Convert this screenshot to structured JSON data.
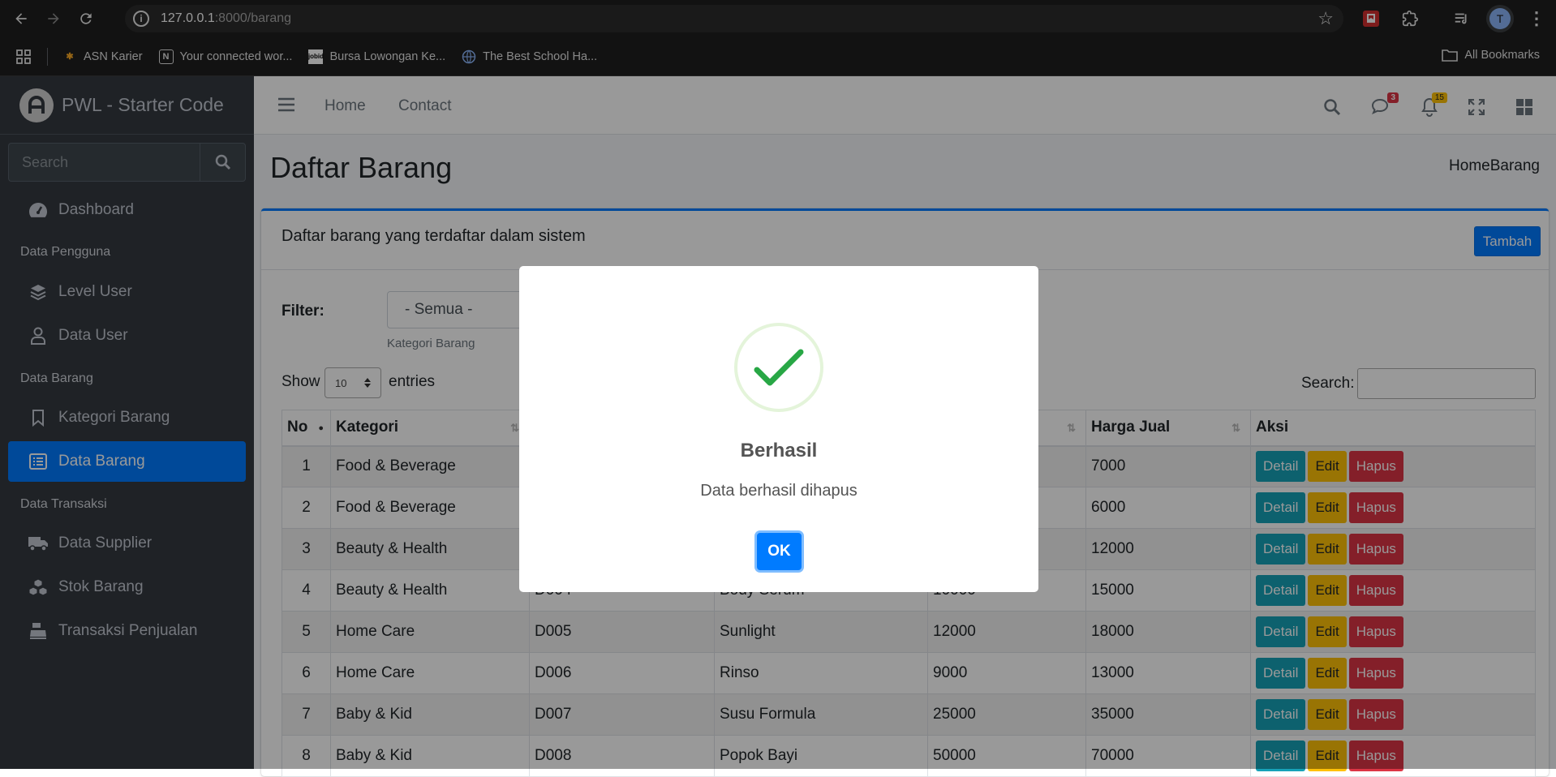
{
  "browser": {
    "url_host": "127.0.0.1",
    "url_rest": ":8000/barang",
    "profile_initial": "T",
    "bookmarks": [
      {
        "label": "ASN Karier"
      },
      {
        "label": "Your connected wor..."
      },
      {
        "label": "Bursa Lowongan Ke..."
      },
      {
        "label": "The Best School Ha..."
      }
    ],
    "all_bookmarks": "All Bookmarks"
  },
  "sidebar": {
    "brand": "PWL - Starter Code",
    "search_placeholder": "Search",
    "dashboard": "Dashboard",
    "section_pengguna": "Data Pengguna",
    "level_user": "Level User",
    "data_user": "Data User",
    "section_barang": "Data Barang",
    "kategori_barang": "Kategori Barang",
    "data_barang": "Data Barang",
    "section_transaksi": "Data Transaksi",
    "data_supplier": "Data Supplier",
    "stok_barang": "Stok Barang",
    "transaksi_penjualan": "Transaksi Penjualan"
  },
  "topnav": {
    "home": "Home",
    "contact": "Contact",
    "messages_count": "3",
    "notifications_count": "15"
  },
  "page": {
    "title": "Daftar Barang",
    "breadcrumb": "HomeBarang",
    "card_title": "Daftar barang yang terdaftar dalam sistem",
    "add_button": "Tambah",
    "filter_label": "Filter:",
    "filter_value": "- Semua -",
    "filter_help": "Kategori Barang",
    "show": "Show",
    "length_value": "10",
    "entries": "entries",
    "search_label": "Search:"
  },
  "table": {
    "headers": [
      "No",
      "Kategori",
      "",
      "",
      "",
      "Harga Jual",
      "Aksi"
    ],
    "rows": [
      [
        "1",
        "Food & Beverage",
        "",
        "",
        "",
        "7000"
      ],
      [
        "2",
        "Food & Beverage",
        "",
        "",
        "",
        "6000"
      ],
      [
        "3",
        "Beauty & Health",
        "",
        "",
        "",
        "12000"
      ],
      [
        "4",
        "Beauty & Health",
        "D004",
        "Body Serum",
        "10000",
        "15000"
      ],
      [
        "5",
        "Home Care",
        "D005",
        "Sunlight",
        "12000",
        "18000"
      ],
      [
        "6",
        "Home Care",
        "D006",
        "Rinso",
        "9000",
        "13000"
      ],
      [
        "7",
        "Baby & Kid",
        "D007",
        "Susu Formula",
        "25000",
        "35000"
      ],
      [
        "8",
        "Baby & Kid",
        "D008",
        "Popok Bayi",
        "50000",
        "70000"
      ]
    ],
    "actions": {
      "detail": "Detail",
      "edit": "Edit",
      "hapus": "Hapus"
    }
  },
  "modal": {
    "title": "Berhasil",
    "text": "Data berhasil dihapus",
    "ok": "OK"
  }
}
